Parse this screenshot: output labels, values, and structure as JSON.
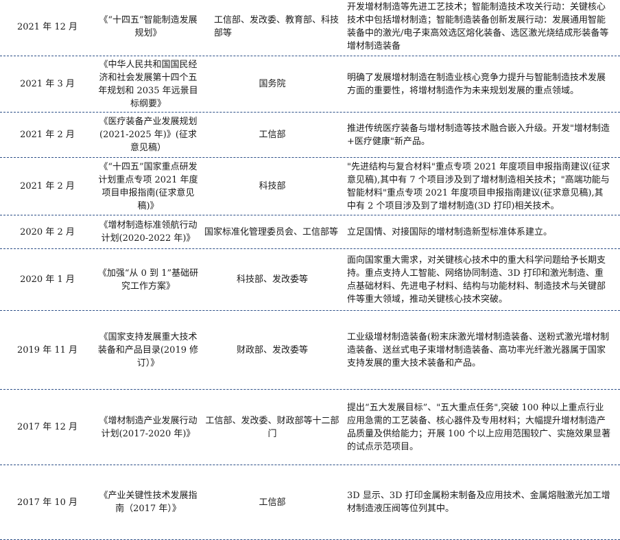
{
  "rows": [
    {
      "date": "2021 年 12 月",
      "title": "《“十四五”智能制造发展规划》",
      "dept": "工信部、发改委、教育部、科技部等",
      "content": "开发增材制造等先进工艺技术；智能制造技术攻关行动：关键核心技术中包括增材制造；智能制造装备创新发展行动：发展通用智能装备中的激光/电子束高效选区熔化装备、选区激光烧结成形装备等增材制造装备"
    },
    {
      "date": "2021 年 3 月",
      "title": "《中华人民共和国国民经济和社会发展第十四个五年规划和 2035 年远景目标纲要》",
      "dept": "国务院",
      "content": "明确了发展增材制造在制造业核心竞争力提升与智能制造技术发展方面的重要性，将增材制造作为未来规划发展的重点领域。"
    },
    {
      "date": "2021 年 2 月",
      "title": "《医疗装备产业发展规划(2021-2025 年)》(征求意见稿）",
      "dept": "工信部",
      "content": "推进传统医疗装备与增材制造等技术融合嵌入升级。开发\"增材制造+医疗健康\"新产品。"
    },
    {
      "date": "2021 年 2 月",
      "title": "《“十四五”国家重点研发计划重点专项 2021 年度项目申报指南(征求意见稿)》",
      "dept": "科技部",
      "content": "\"先进结构与复合材料\"重点专项 2021 年度项目申报指南建议(征求意见稿),其中有 7 个项目涉及到了增材制造相关技术；\"高端功能与智能材料\"重点专项 2021 年度项目申报指南建议(征求意见稿),其中有 2 个项目涉及到了增材制造(3D 打印)相关技术。"
    },
    {
      "date": "2020 年 2 月",
      "title": "《增材制造标准领航行动计划(2020-2022 年)》",
      "dept": "国家标准化管理委员会、工信部等",
      "content": "立足国情、对接国际的增材制造新型标准体系建立。"
    },
    {
      "date": "2020 年 1 月",
      "title": "《加强“从 0 到 1”基础研究工作方案》",
      "dept": "科技部、发改委等",
      "content": "面向国家重大需求，对关键核心技术中的重大科学问题给予长期支持。重点支持人工智能、网络协同制造、3D 打印和激光制造、重点基础材料、先进电子材料、结构与功能材料、制造技术与关键部件等重大领域，推动关键核心技术突破。"
    },
    {
      "date": "2019 年 11 月",
      "title": "《国家支持发展重大技术装备和产品目录(2019 修订）》",
      "dept": "财政部、发改委等",
      "content": "工业级增材制造装备(粉末床激光增材制造装备、送粉式激光增材制造装备、送丝式电子束增材制造装备、高功率光纤激光器属于国家支持发展的重大技术装备和产品。"
    },
    {
      "date": "2017 年 12 月",
      "title": "《增材制造产业发展行动计划(2017-2020 年)》",
      "dept": "工信部、发改委、财政部等十二部门",
      "content": "提出“五大发展目标”、\"五大重点任务\",突破 100 种以上重点行业应用急需的工艺装备、核心器件及专用材料；大幅提升增材制造产品质量及供给能力；开展 100 个以上应用范围较广、实施效果显著的试点示范项目。"
    },
    {
      "date": "2017 年 10 月",
      "title": "《产业关键性技术发展指南（2017 年）》",
      "dept": "工信部",
      "content": "3D 显示、3D 打印金属粉末制备及应用技术、金属熔融激光加工增材制造液压阀等位列其中。"
    }
  ]
}
